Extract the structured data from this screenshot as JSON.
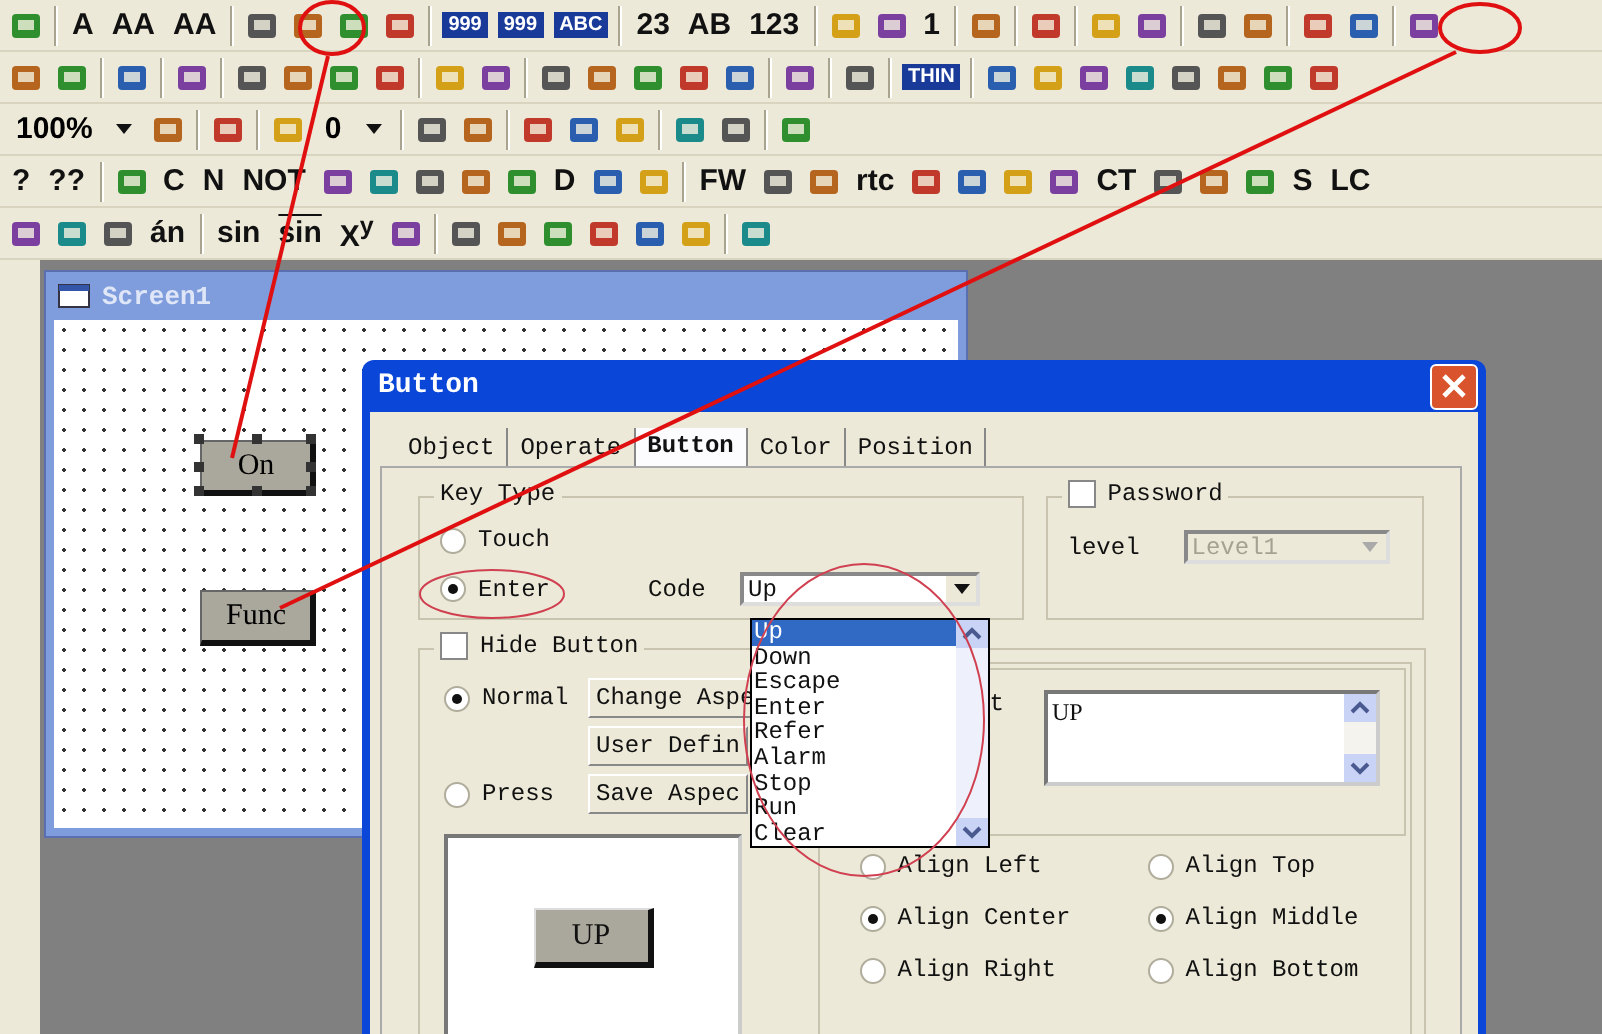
{
  "toolbars": [
    [
      {
        "kind": "icon"
      },
      {
        "kind": "sep"
      },
      {
        "kind": "text",
        "text": "A"
      },
      {
        "kind": "text",
        "text": "AA"
      },
      {
        "kind": "text",
        "text": "AA"
      },
      {
        "kind": "sep"
      },
      {
        "kind": "icon"
      },
      {
        "kind": "icon"
      },
      {
        "kind": "icon"
      },
      {
        "kind": "icon"
      },
      {
        "kind": "sep"
      },
      {
        "kind": "label",
        "text": "999"
      },
      {
        "kind": "label",
        "text": "999"
      },
      {
        "kind": "label",
        "text": "ABC"
      },
      {
        "kind": "sep"
      },
      {
        "kind": "text",
        "text": "23"
      },
      {
        "kind": "text",
        "text": "AB"
      },
      {
        "kind": "text",
        "text": "123"
      },
      {
        "kind": "sep"
      },
      {
        "kind": "icon"
      },
      {
        "kind": "icon"
      },
      {
        "kind": "text",
        "text": "1"
      },
      {
        "kind": "sep"
      },
      {
        "kind": "icon"
      },
      {
        "kind": "sep"
      },
      {
        "kind": "icon"
      },
      {
        "kind": "sep"
      },
      {
        "kind": "icon"
      },
      {
        "kind": "icon"
      },
      {
        "kind": "sep"
      },
      {
        "kind": "icon"
      },
      {
        "kind": "icon"
      },
      {
        "kind": "sep"
      },
      {
        "kind": "icon"
      },
      {
        "kind": "icon"
      },
      {
        "kind": "sep"
      },
      {
        "kind": "icon"
      }
    ],
    [
      {
        "kind": "icon"
      },
      {
        "kind": "icon"
      },
      {
        "kind": "sep"
      },
      {
        "kind": "icon"
      },
      {
        "kind": "sep"
      },
      {
        "kind": "icon"
      },
      {
        "kind": "sep"
      },
      {
        "kind": "icon"
      },
      {
        "kind": "icon"
      },
      {
        "kind": "icon"
      },
      {
        "kind": "icon"
      },
      {
        "kind": "sep"
      },
      {
        "kind": "icon"
      },
      {
        "kind": "icon"
      },
      {
        "kind": "sep"
      },
      {
        "kind": "icon"
      },
      {
        "kind": "icon"
      },
      {
        "kind": "icon"
      },
      {
        "kind": "icon"
      },
      {
        "kind": "icon"
      },
      {
        "kind": "sep"
      },
      {
        "kind": "icon"
      },
      {
        "kind": "sep"
      },
      {
        "kind": "icon"
      },
      {
        "kind": "sep"
      },
      {
        "kind": "label",
        "text": "THIN"
      },
      {
        "kind": "sep"
      },
      {
        "kind": "icon"
      },
      {
        "kind": "icon"
      },
      {
        "kind": "icon"
      },
      {
        "kind": "icon"
      },
      {
        "kind": "icon"
      },
      {
        "kind": "icon"
      },
      {
        "kind": "icon"
      },
      {
        "kind": "icon"
      }
    ],
    [
      {
        "kind": "combo",
        "text": "100%"
      },
      {
        "kind": "icon"
      },
      {
        "kind": "sep"
      },
      {
        "kind": "icon"
      },
      {
        "kind": "sep"
      },
      {
        "kind": "icon"
      },
      {
        "kind": "combo",
        "text": "0"
      },
      {
        "kind": "sep"
      },
      {
        "kind": "icon"
      },
      {
        "kind": "icon"
      },
      {
        "kind": "sep"
      },
      {
        "kind": "icon"
      },
      {
        "kind": "icon"
      },
      {
        "kind": "icon"
      },
      {
        "kind": "sep"
      },
      {
        "kind": "icon"
      },
      {
        "kind": "icon"
      },
      {
        "kind": "sep"
      },
      {
        "kind": "icon"
      }
    ],
    [
      {
        "kind": "text",
        "text": "?"
      },
      {
        "kind": "text",
        "text": "??"
      },
      {
        "kind": "sep"
      },
      {
        "kind": "icon"
      },
      {
        "kind": "text",
        "text": "C"
      },
      {
        "kind": "text",
        "text": "N"
      },
      {
        "kind": "text",
        "text": "NOT"
      },
      {
        "kind": "icon"
      },
      {
        "kind": "icon"
      },
      {
        "kind": "icon"
      },
      {
        "kind": "icon"
      },
      {
        "kind": "icon"
      },
      {
        "kind": "text",
        "text": "D"
      },
      {
        "kind": "icon"
      },
      {
        "kind": "icon"
      },
      {
        "kind": "sep"
      },
      {
        "kind": "text",
        "text": "FW"
      },
      {
        "kind": "icon"
      },
      {
        "kind": "icon"
      },
      {
        "kind": "text",
        "text": "rtc"
      },
      {
        "kind": "icon"
      },
      {
        "kind": "icon"
      },
      {
        "kind": "icon"
      },
      {
        "kind": "icon"
      },
      {
        "kind": "text",
        "text": "CT"
      },
      {
        "kind": "icon"
      },
      {
        "kind": "icon"
      },
      {
        "kind": "icon"
      },
      {
        "kind": "text",
        "text": "S"
      },
      {
        "kind": "text",
        "text": "LC"
      }
    ],
    [
      {
        "kind": "icon"
      },
      {
        "kind": "icon"
      },
      {
        "kind": "icon"
      },
      {
        "kind": "text",
        "text": "án"
      },
      {
        "kind": "sep"
      },
      {
        "kind": "text",
        "text": "sin"
      },
      {
        "kind": "overline",
        "text": "sin"
      },
      {
        "kind": "text",
        "text": "X$^{y}$"
      },
      {
        "kind": "icon"
      },
      {
        "kind": "sep"
      },
      {
        "kind": "icon"
      },
      {
        "kind": "icon"
      },
      {
        "kind": "icon"
      },
      {
        "kind": "icon"
      },
      {
        "kind": "icon"
      },
      {
        "kind": "icon"
      },
      {
        "kind": "sep"
      },
      {
        "kind": "icon"
      }
    ]
  ],
  "screen_window": {
    "title": "Screen1",
    "buttons": [
      {
        "label": "On",
        "selected": true
      },
      {
        "label": "Func",
        "selected": false
      }
    ]
  },
  "dialog": {
    "title": "Button",
    "tabs": [
      {
        "label": "Object",
        "selected": false
      },
      {
        "label": "Operate",
        "selected": false
      },
      {
        "label": "Button",
        "selected": true
      },
      {
        "label": "Color",
        "selected": false
      },
      {
        "label": "Position",
        "selected": false
      }
    ],
    "key_type": {
      "label": "Key Type",
      "options": [
        {
          "label": "Touch",
          "selected": false
        },
        {
          "label": "Enter",
          "selected": true
        }
      ],
      "code_label": "Code",
      "code_value": "Up"
    },
    "password": {
      "label": "Password",
      "checked": false,
      "level_label": "level",
      "level_value": "Level1",
      "disabled": true
    },
    "hide_button": {
      "label": "Hide Button",
      "checked": false
    },
    "aspect": {
      "options": [
        {
          "label": "Normal",
          "selected": true
        },
        {
          "label": "Press",
          "selected": false
        }
      ],
      "buttons": [
        "Change Aspe",
        "User Defin",
        "Save Aspec"
      ],
      "preview_label": "UP"
    },
    "text_group": {
      "label": "t",
      "text": "UP"
    },
    "align": [
      {
        "label": "Align Left",
        "selected": false
      },
      {
        "label": "Align Top",
        "selected": false
      },
      {
        "label": "Align Center",
        "selected": true
      },
      {
        "label": "Align Middle",
        "selected": true
      },
      {
        "label": "Align Right",
        "selected": false
      },
      {
        "label": "Align Bottom",
        "selected": false
      }
    ],
    "code_list": [
      {
        "label": "Up",
        "selected": true
      },
      {
        "label": "Down",
        "selected": false
      },
      {
        "label": "Escape",
        "selected": false
      },
      {
        "label": "Enter",
        "selected": false
      },
      {
        "label": "Refer",
        "selected": false
      },
      {
        "label": "Alarm",
        "selected": false
      },
      {
        "label": "Stop",
        "selected": false
      },
      {
        "label": "Run",
        "selected": false
      },
      {
        "label": "Clear",
        "selected": false
      }
    ]
  }
}
